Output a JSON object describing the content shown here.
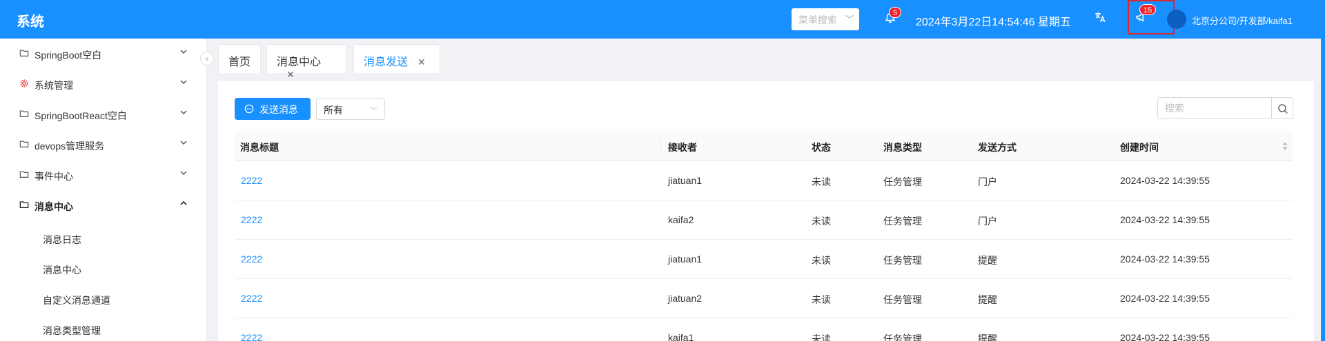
{
  "header": {
    "brand": "系统",
    "menu_search_placeholder": "菜单搜索",
    "bell_badge": "5",
    "datetime": "2024年3月22日14:54:46 星期五",
    "notice_badge": "15",
    "user": "北京分公司/开发部/kaifa1",
    "colors": {
      "primary": "#1890ff",
      "badge": "#f5222d",
      "highlight": "#e0262b"
    }
  },
  "sidebar": {
    "items": [
      {
        "label": "SpringBoot空白",
        "icon": "folder-icon",
        "expanded": false
      },
      {
        "label": "系统管理",
        "icon": "gear-icon",
        "expanded": false
      },
      {
        "label": "SpringBootReact空白",
        "icon": "folder-icon",
        "expanded": false
      },
      {
        "label": "devops管理服务",
        "icon": "folder-icon",
        "expanded": false
      },
      {
        "label": "事件中心",
        "icon": "folder-icon",
        "expanded": false
      },
      {
        "label": "消息中心",
        "icon": "folder-icon",
        "expanded": true
      }
    ],
    "subitems": [
      {
        "label": "消息日志"
      },
      {
        "label": "消息中心"
      },
      {
        "label": "自定义消息通道"
      },
      {
        "label": "消息类型管理"
      }
    ]
  },
  "tabs": [
    {
      "label": "首页",
      "closable": false,
      "active": false
    },
    {
      "label": "消息中心",
      "closable": true,
      "active": false
    },
    {
      "label": "消息发送",
      "closable": true,
      "active": true
    }
  ],
  "toolbar": {
    "send_label": "发送消息",
    "filter_value": "所有",
    "search_placeholder": "搜索"
  },
  "table": {
    "columns": [
      "消息标题",
      "接收者",
      "状态",
      "消息类型",
      "发送方式",
      "创建时间"
    ],
    "rows": [
      [
        "2222",
        "jiatuan1",
        "未读",
        "任务管理",
        "门户",
        "2024-03-22 14:39:55"
      ],
      [
        "2222",
        "kaifa2",
        "未读",
        "任务管理",
        "门户",
        "2024-03-22 14:39:55"
      ],
      [
        "2222",
        "jiatuan1",
        "未读",
        "任务管理",
        "提醒",
        "2024-03-22 14:39:55"
      ],
      [
        "2222",
        "jiatuan2",
        "未读",
        "任务管理",
        "提醒",
        "2024-03-22 14:39:55"
      ],
      [
        "2222",
        "kaifa1",
        "未读",
        "任务管理",
        "提醒",
        "2024-03-22 14:39:55"
      ]
    ]
  }
}
